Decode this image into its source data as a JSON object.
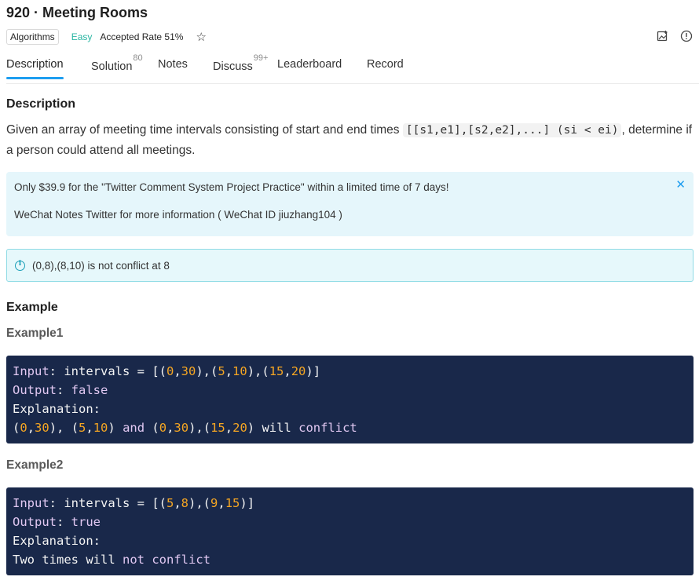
{
  "problem": {
    "title": "920 · Meeting Rooms",
    "tag": "Algorithms",
    "difficulty": "Easy",
    "accepted_rate": "Accepted Rate 51%"
  },
  "tabs": [
    {
      "label": "Description",
      "badge": ""
    },
    {
      "label": "Solution",
      "badge": "80"
    },
    {
      "label": "Notes",
      "badge": ""
    },
    {
      "label": "Discuss",
      "badge": "99+"
    },
    {
      "label": "Leaderboard",
      "badge": ""
    },
    {
      "label": "Record",
      "badge": ""
    }
  ],
  "description": {
    "heading": "Description",
    "text_before": "Given an array of meeting time intervals consisting of start and end times ",
    "code": "[[s1,e1],[s2,e2],...] (si < ei)",
    "text_after": ", determine if a person could attend all meetings."
  },
  "promo": {
    "line1": "Only $39.9 for the \"Twitter Comment System Project Practice\" within a limited time of 7 days!",
    "line2": "WeChat Notes Twitter for more information ( WeChat ID jiuzhang104 )",
    "close": "✕"
  },
  "note": {
    "text": "(0,8),(8,10) is not conflict at 8"
  },
  "examples": {
    "heading": "Example",
    "items": [
      {
        "title": "Example1",
        "line1": [
          "Input",
          ": intervals = [(",
          "0",
          ",",
          "30",
          "),(",
          "5",
          ",",
          "10",
          "),(",
          "15",
          ",",
          "20",
          ")]"
        ],
        "line2": [
          "Output",
          ": ",
          "false"
        ],
        "line3": "Explanation:",
        "line4": [
          "(",
          "0",
          ",",
          "30",
          "), (",
          "5",
          ",",
          "10",
          ") ",
          "and",
          " (",
          "0",
          ",",
          "30",
          "),(",
          "15",
          ",",
          "20",
          ") will ",
          "conflict"
        ]
      },
      {
        "title": "Example2",
        "line1": [
          "Input",
          ": intervals = [(",
          "5",
          ",",
          "8",
          "),(",
          "9",
          ",",
          "15",
          ")]"
        ],
        "line2": [
          "Output",
          ": ",
          "true"
        ],
        "line3": "Explanation:",
        "line4": [
          "Two times will ",
          "not",
          " ",
          "conflict"
        ]
      }
    ]
  },
  "icons": {
    "star": "star-outline-icon",
    "share": "share-image-icon",
    "info": "info-circle-icon"
  }
}
